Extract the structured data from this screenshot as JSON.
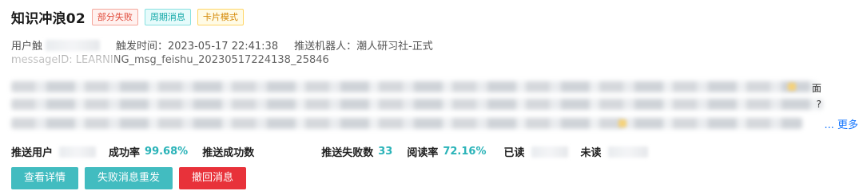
{
  "card": {
    "title": "知识冲浪02",
    "tags": [
      "部分失败",
      "周期消息",
      "卡片模式"
    ]
  },
  "meta": {
    "user_label": "用户触",
    "trigger_time": "触发时间：2023-05-17 22:41:38",
    "robot": "推送机器人：潮人研习社-正式"
  },
  "message": {
    "text": "messageID: LEARNING_msg_feishu_20230517224138_25846"
  },
  "content": {
    "side_glyph_1": "面",
    "side_glyph_2": "?",
    "more": "... 更多"
  },
  "stats": {
    "push_users_label": "推送用户",
    "success_rate_label": "成功率",
    "success_rate_value": "99.68%",
    "push_success_label": "推送成功数",
    "push_fail_label": "推送失败数",
    "push_fail_value": "33",
    "read_rate_label": "阅读率",
    "read_rate_value": "72.16%",
    "read_label": "已读",
    "unread_label": "未读"
  },
  "actions": {
    "details": "查看详情",
    "resend_failed": "失败消息重发",
    "recall": "撤回消息"
  },
  "colors": {
    "accent_teal": "#42bcc0",
    "danger_red": "#e8323a",
    "stat_value": "#2ab3b8",
    "link_blue": "#1677ff"
  }
}
